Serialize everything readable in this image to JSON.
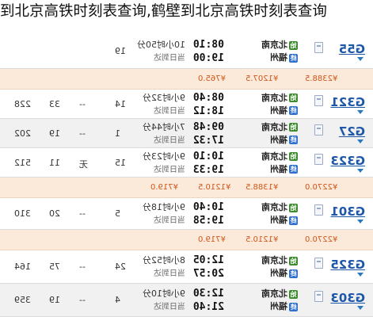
{
  "title": "到北京高铁时刻表查询,鹤壁到北京高铁时刻表查询",
  "rows": [
    {
      "kind": "train",
      "train_no": "G55",
      "from_station": "北京南",
      "to_station": "福州",
      "depart": "08:10",
      "arrive": "19:00",
      "duration": "10小时50分",
      "duration_note": "当日到达",
      "seats": [
        "19",
        "",
        "",
        ""
      ]
    },
    {
      "kind": "price",
      "prices": [
        "¥2388.5",
        "¥1207.5",
        "¥765.0"
      ]
    },
    {
      "kind": "train",
      "train_no": "G321",
      "from_station": "北京南",
      "to_station": "福州",
      "depart": "08:40",
      "arrive": "18:12",
      "duration": "9小时32分",
      "duration_note": "当日到达",
      "seats": [
        "14",
        "--",
        "33",
        "228"
      ]
    },
    {
      "kind": "train",
      "train_no": "G27",
      "from_station": "北京南",
      "to_station": "福州",
      "depart": "09:48",
      "arrive": "17:32",
      "duration": "7小时44分",
      "duration_note": "当日到达",
      "seats": [
        "1",
        "--",
        "19",
        "202"
      ]
    },
    {
      "kind": "train",
      "train_no": "G323",
      "from_station": "北京南",
      "to_station": "福州",
      "depart": "10:10",
      "arrive": "19:33",
      "duration": "9小时23分",
      "duration_note": "当日到达",
      "seats": [
        "15",
        "无",
        "11",
        "512"
      ]
    },
    {
      "kind": "price",
      "prices": [
        "¥2270.0",
        "¥1388.5",
        "¥1210.5",
        "¥719.0"
      ]
    },
    {
      "kind": "train",
      "train_no": "G301",
      "from_station": "北京南",
      "to_station": "福州",
      "depart": "10:40",
      "arrive": "19:58",
      "duration": "9小时18分",
      "duration_note": "当日到达",
      "seats": [
        "5",
        "--",
        "20",
        "310"
      ]
    },
    {
      "kind": "price",
      "prices": [
        "¥2270.0",
        "¥1210.5",
        "¥719.0"
      ]
    },
    {
      "kind": "train",
      "train_no": "G325",
      "from_station": "北京南",
      "to_station": "福州",
      "depart": "12:05",
      "arrive": "20:57",
      "duration": "8小时52分",
      "duration_note": "当日到达",
      "seats": [
        "24",
        "--",
        "75",
        "164"
      ]
    },
    {
      "kind": "train",
      "train_no": "G303",
      "from_station": "北京南",
      "to_station": "福州",
      "depart": "12:30",
      "arrive": "21:40",
      "duration": "9小时10分",
      "duration_note": "当日到达",
      "seats": [
        "4",
        "--",
        "19",
        "359"
      ]
    }
  ]
}
